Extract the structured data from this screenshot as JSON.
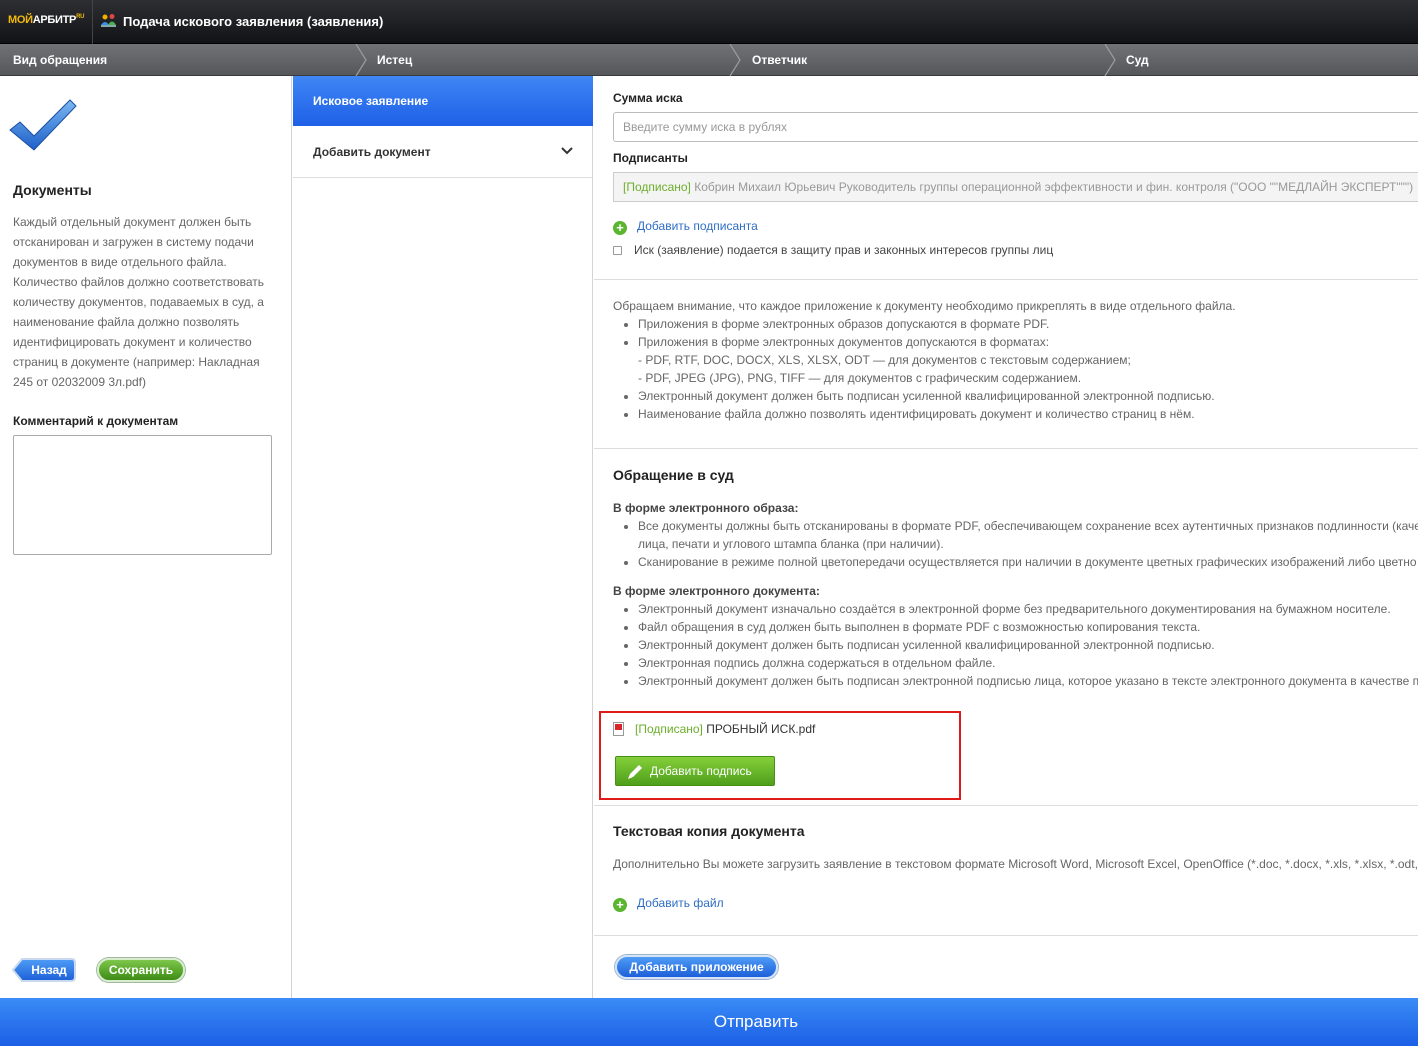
{
  "app": {
    "logo": {
      "moi": "МОЙ",
      "arbitr": "АРБИТР",
      "ru": "RU"
    },
    "title": "Подача искового заявления (заявления)"
  },
  "steps": [
    "Вид обращения",
    "Истец",
    "Ответчик",
    "Суд"
  ],
  "left": {
    "heading": "Документы",
    "description": "Каждый отдельный документ должен быть отсканирован и загружен в систему подачи документов в виде отдельного файла. Количество файлов должно соответствовать количеству документов, подаваемых в суд, а наименование файла должно позволять идентифицировать документ и количество страниц в документе (например: Накладная 245 от 02032009 3л.pdf)",
    "comment_label": "Комментарий к документам",
    "comment_value": "",
    "back_label": "Назад",
    "save_label": "Сохранить"
  },
  "middle": {
    "active_item": "Исковое заявление",
    "add_document": "Добавить документ"
  },
  "right": {
    "sum_label": "Сумма иска",
    "sum_placeholder": "Введите сумму иска в рублях",
    "signers_label": "Подписанты",
    "signer_status": "[Подписано]",
    "signer_name": " Кобрин Михаил Юрьевич Руководитель группы операционной эффективности и фин. контроля (\"ООО \"\"МЕДЛАЙН ЭКСПЕРТ\"\"\")",
    "add_signer": "Добавить подписанта",
    "group_checkbox": "Иск (заявление) подается в защиту прав и законных интересов группы лиц",
    "notice": {
      "intro": "Обращаем внимание, что каждое приложение к документу необходимо прикреплять в виде отдельного файла.",
      "item1": "Приложения в форме электронных образов допускаются в формате PDF.",
      "item2": "Приложения в форме электронных документов допускаются в форматах:",
      "item2_a": "- PDF, RTF, DOC, DOCX, XLS, XLSX, ODT — для документов с текстовым содержанием;",
      "item2_b": "- PDF, JPEG (JPG), PNG, TIFF — для документов с графическим содержанием.",
      "item3": "Электронный документ должен быть подписан усиленной квалифицированной электронной подписью.",
      "item4": "Наименование файла должно позволять идентифицировать документ и количество страниц в нём."
    },
    "court": {
      "title": "Обращение в суд",
      "image_heading": "В форме электронного образа:",
      "image_item1": "Все документы должны быть отсканированы в формате PDF, обеспечивающем сохранение всех аутентичных признаков подлинности (качес",
      "image_item1_cont": "лица, печати и углового штампа бланка (при наличии).",
      "image_item2": "Сканирование в режиме полной цветопередачи осуществляется при наличии в документе цветных графических изображений либо цветно",
      "doc_heading": "В форме электронного документа:",
      "doc_item1": "Электронный документ изначально создаётся в электронной форме без предварительного документирования на бумажном носителе.",
      "doc_item2": "Файл обращения в суд должен быть выполнен в формате PDF с возможностью копирования текста.",
      "doc_item3": "Электронный документ должен быть подписан усиленной квалифицированной электронной подписью.",
      "doc_item4": "Электронная подпись должна содержаться в отдельном файле.",
      "doc_item5": "Электронный документ должен быть подписан электронной подписью лица, которое указано в тексте электронного документа в качестве п"
    },
    "file": {
      "status": "[Подписано]",
      "name": " ПРОБНЫЙ ИСК.pdf",
      "add_signature": "Добавить подпись"
    },
    "text_copy": {
      "title": "Текстовая копия документа",
      "desc": "Дополнительно Вы можете загрузить заявление в текстовом формате Microsoft Word, Microsoft Excel, OpenOffice (*.doc, *.docx, *.xls, *.xlsx, *.odt,",
      "add_file": "Добавить файл"
    },
    "add_appendix": "Добавить приложение"
  },
  "submit_label": "Отправить",
  "colors": {
    "accent_blue": "#1e60e6",
    "green": "#5bb530",
    "highlight_red": "#e01919"
  }
}
